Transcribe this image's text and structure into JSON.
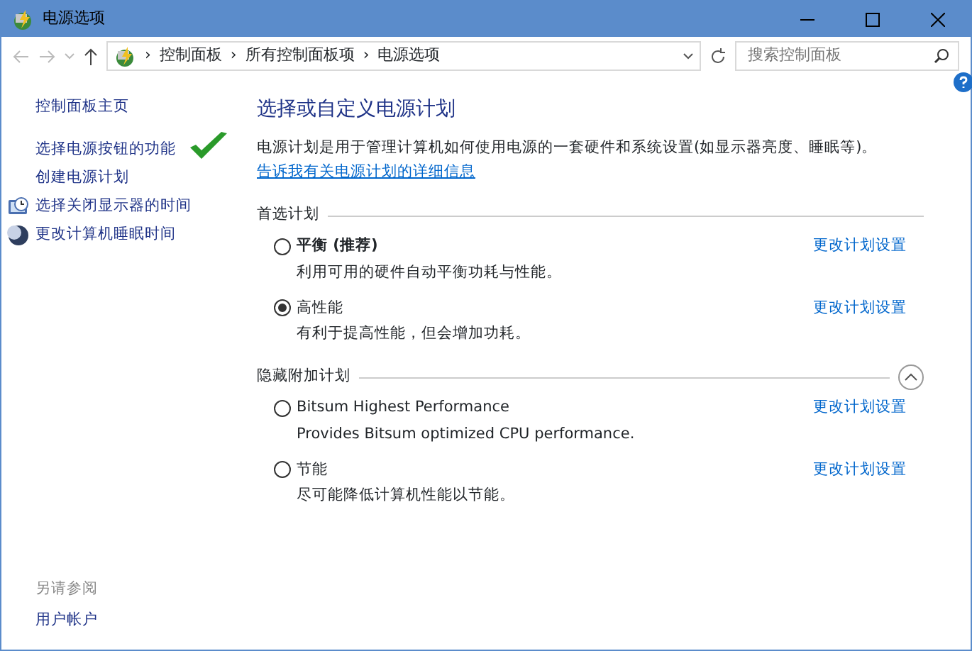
{
  "window": {
    "title": "电源选项"
  },
  "address_bar": {
    "separator": "›",
    "crumbs": [
      "控制面板",
      "所有控制面板项",
      "电源选项"
    ],
    "search": {
      "placeholder": "搜索控制面板"
    }
  },
  "sidebar": {
    "home": "控制面板主页",
    "tasks": [
      {
        "label": "选择电源按钮的功能",
        "kind": "plain"
      },
      {
        "label": "创建电源计划",
        "kind": "plain"
      },
      {
        "label": "选择关闭显示器的时间",
        "kind": "monitor"
      },
      {
        "label": "更改计算机睡眠时间",
        "kind": "sleep"
      }
    ],
    "see_also": {
      "heading": "另请参阅",
      "links": [
        "用户帐户"
      ]
    }
  },
  "main": {
    "heading": "选择或自定义电源计划",
    "intro": "电源计划是用于管理计算机如何使用电源的一套硬件和系统设置(如显示器亮度、睡眠等)。",
    "intro_link": "告诉我有关电源计划的详细信息",
    "sections": [
      {
        "title": "首选计划",
        "kind": "static",
        "plans": [
          {
            "name": "平衡 (推荐)",
            "emphasized": true,
            "description": "利用可用的硬件自动平衡功耗与性能。",
            "selected": false,
            "link": "更改计划设置"
          },
          {
            "name": "高性能",
            "emphasized": false,
            "description": "有利于提高性能，但会增加功耗。",
            "selected": true,
            "link": "更改计划设置"
          }
        ]
      },
      {
        "title": "隐藏附加计划",
        "kind": "collapsible",
        "expanded": true,
        "plans": [
          {
            "name": "Bitsum Highest Performance",
            "emphasized": false,
            "description": "Provides Bitsum optimized CPU performance.",
            "selected": false,
            "link": "更改计划设置"
          },
          {
            "name": "节能",
            "emphasized": false,
            "description": "尽可能降低计算机性能以节能。",
            "selected": false,
            "link": "更改计划设置"
          }
        ]
      }
    ]
  }
}
